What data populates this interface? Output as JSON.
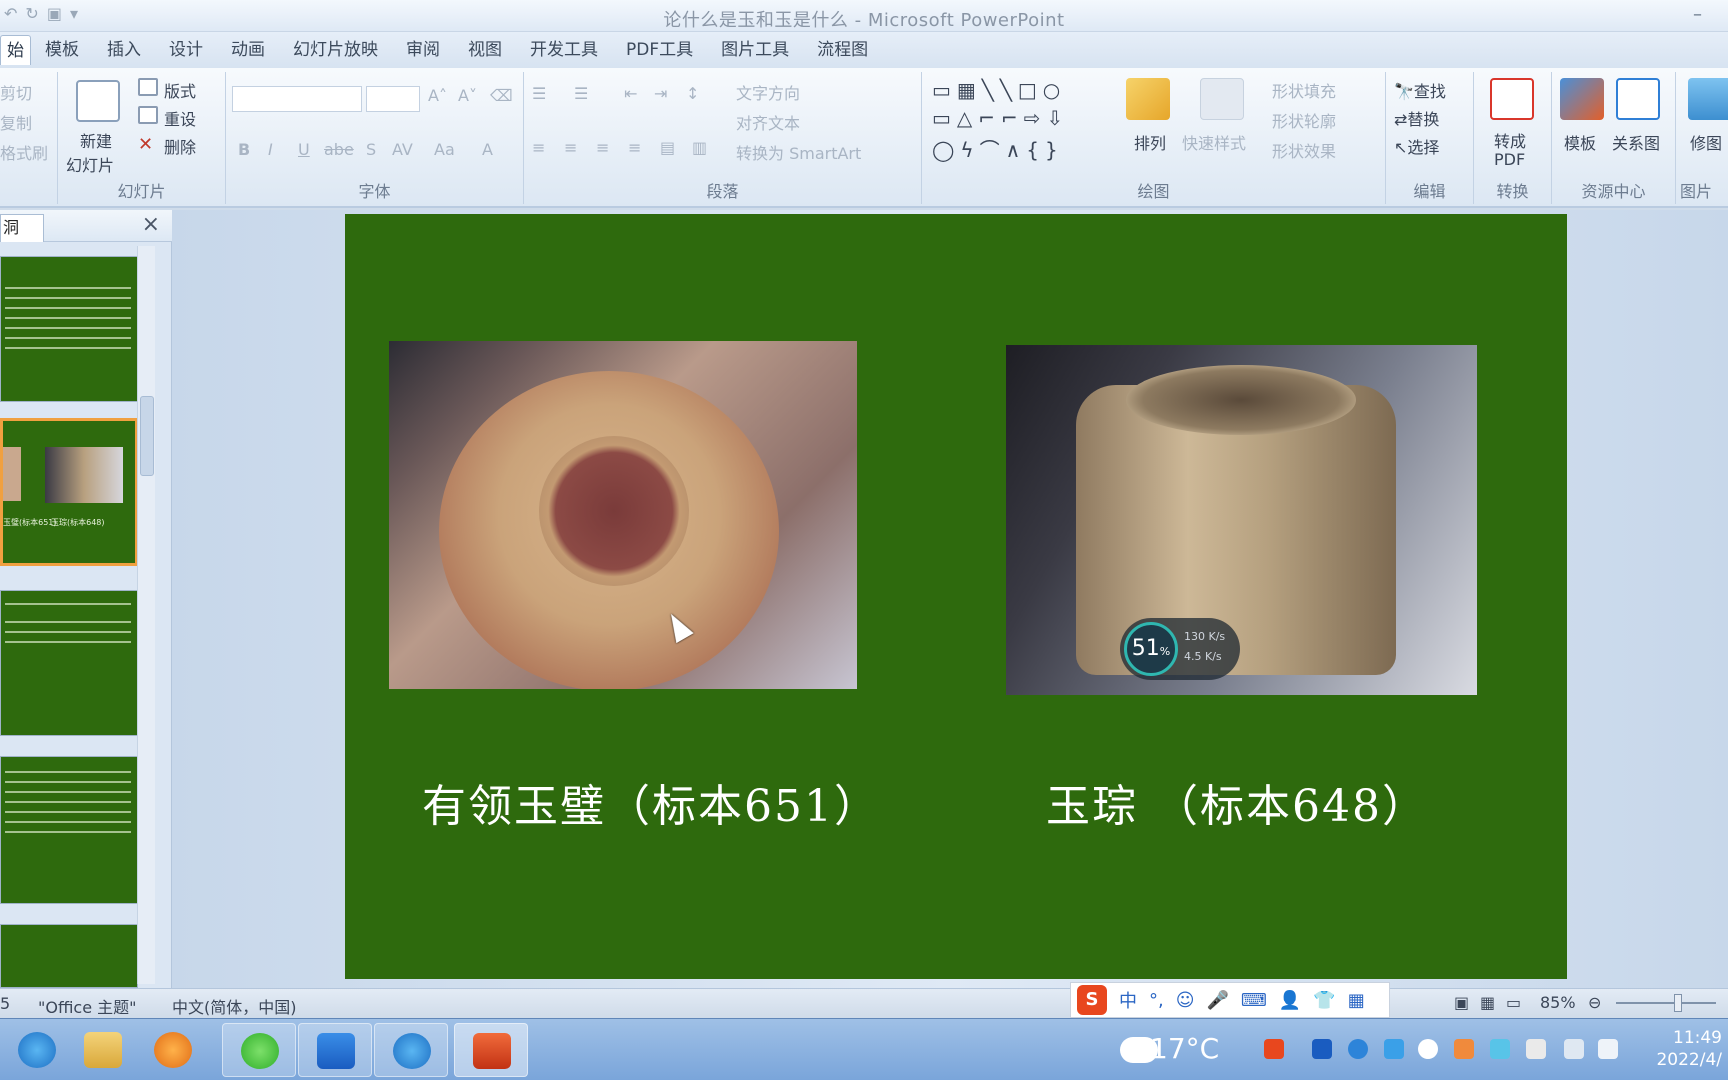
{
  "window": {
    "title": "论什么是玉和玉是什么 - Microsoft PowerPoint"
  },
  "tabs": [
    "始",
    "模板",
    "插入",
    "设计",
    "动画",
    "幻灯片放映",
    "审阅",
    "视图",
    "开发工具",
    "PDF工具",
    "图片工具",
    "流程图"
  ],
  "ribbon": {
    "clipboard": {
      "cut": "剪切",
      "copy": "复制",
      "format_painter": "格式刷"
    },
    "slides": {
      "new_slide": "新建\n幻灯片",
      "new_slide_l1": "新建",
      "new_slide_l2": "幻灯片",
      "layout": "版式",
      "reset": "重设",
      "delete": "删除",
      "label": "幻灯片"
    },
    "font": {
      "label": "字体",
      "buttons": [
        "B",
        "I",
        "U",
        "abe",
        "S",
        "AV",
        "Aa",
        "A"
      ]
    },
    "paragraph": {
      "label": "段落",
      "text_direction": "文字方向",
      "align_text": "对齐文本",
      "convert_smartart": "转换为 SmartArt"
    },
    "drawing": {
      "label": "绘图",
      "arrange": "排列",
      "quick_styles": "快速样式",
      "shape_fill": "形状填充",
      "shape_outline": "形状轮廓",
      "shape_effects": "形状效果"
    },
    "editing": {
      "label": "编辑",
      "find": "查找",
      "replace": "替换",
      "select": "选择"
    },
    "convert": {
      "label": "转换",
      "to_pdf_l1": "转成",
      "to_pdf_l2": "PDF"
    },
    "resources": {
      "label": "资源中心",
      "template": "模板",
      "relation": "关系图"
    },
    "picture": {
      "label": "图片",
      "modify": "修图"
    }
  },
  "left_pane": {
    "tab_label": "洞",
    "close": "×",
    "thumb_captions": [
      "玉璧(标本651)",
      "玉琮(标本648)"
    ]
  },
  "slide": {
    "caption_left": "有领玉璧（标本651）",
    "caption_right": "玉琮 （标本648）",
    "net_widget": {
      "percent": "51",
      "percent_unit": "%",
      "up": "130 K/s",
      "down": "4.5 K/s"
    }
  },
  "status": {
    "slide_num": "5",
    "theme": "\"Office 主题\"",
    "language": "中文(简体，中国)",
    "zoom": "85%"
  },
  "ime": {
    "logo": "S",
    "mode": "中",
    "punct": "°,",
    "items": [
      "☺",
      "🎤",
      "⌨",
      "👤",
      "👕",
      "▦"
    ]
  },
  "taskbar": {
    "weather_temp": "17°C",
    "time": "11:49",
    "date": "2022/4/"
  },
  "colors": {
    "slide_bg": "#2e6a0d",
    "caption": "#ffffff",
    "ribbon_bg": "#dce7f3",
    "taskbar": "#7aa5da"
  }
}
